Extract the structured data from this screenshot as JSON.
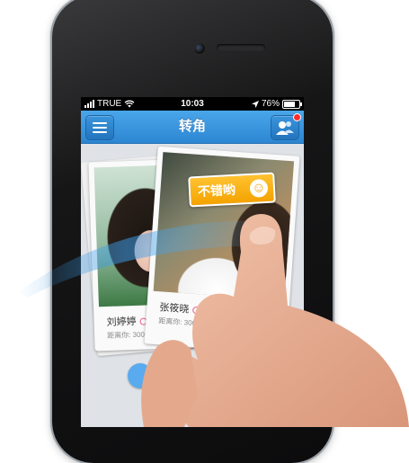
{
  "statusbar": {
    "carrier": "TRUE",
    "time": "10:03",
    "battery": "76%",
    "icons": [
      "signal-icon",
      "wifi-icon",
      "location-arrow-icon",
      "battery-icon"
    ]
  },
  "navbar": {
    "title": "转角",
    "left_icon": "menu-icon",
    "right_icon": "friends-icon",
    "badge_color": "#ff2d2d"
  },
  "cards": [
    {
      "name": "刘婷婷",
      "distance": "距离你: 300m",
      "gender_icon": "female-icon"
    },
    {
      "name": "张筱晓",
      "distance": "距离你: 300m",
      "gender_icon": "female-icon"
    }
  ],
  "stamp": {
    "label": "不错哟",
    "icon": "smiley-icon"
  },
  "colors": {
    "nav_blue": "#2c86d2",
    "stamp_orange": "#f4a300",
    "swipe_blue": "#3a9be8"
  }
}
